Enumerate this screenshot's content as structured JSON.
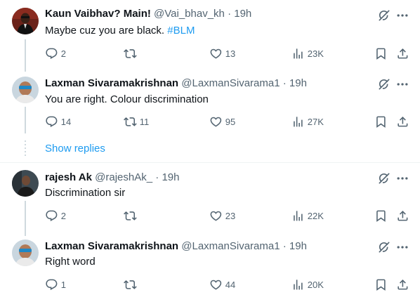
{
  "tweets": [
    {
      "name": "Kaun Vaibhav? Main!",
      "handle": "@Vai_bhav_kh",
      "sep": "·",
      "time": "19h",
      "text": "Maybe cuz you are black. ",
      "hashtag": "#BLM",
      "replies": "2",
      "retweets": "",
      "likes": "13",
      "views": "23K"
    },
    {
      "name": "Laxman Sivaramakrishnan",
      "handle": "@LaxmanSivarama1",
      "sep": "·",
      "time": "19h",
      "text": "You are right. Colour discrimination",
      "hashtag": "",
      "replies": "14",
      "retweets": "11",
      "likes": "95",
      "views": "27K"
    },
    {
      "name": "rajesh Ak",
      "handle": "@rajeshAk_",
      "sep": "·",
      "time": "19h",
      "text": "Discrimination sir",
      "hashtag": "",
      "replies": "2",
      "retweets": "",
      "likes": "23",
      "views": "22K"
    },
    {
      "name": "Laxman Sivaramakrishnan",
      "handle": "@LaxmanSivarama1",
      "sep": "·",
      "time": "19h",
      "text": "Right word",
      "hashtag": "",
      "replies": "1",
      "retweets": "",
      "likes": "44",
      "views": "20K"
    }
  ],
  "show_replies_label": "Show replies",
  "icons": {
    "reply": "reply-icon",
    "retweet": "retweet-icon",
    "like": "heart-icon",
    "views": "views-icon",
    "bookmark": "bookmark-icon",
    "share": "share-icon",
    "grok": "grok-icon",
    "more": "more-icon"
  },
  "colors": {
    "link": "#1d9bf0",
    "secondary_text": "#536471",
    "thread_line": "#cfd9de"
  }
}
